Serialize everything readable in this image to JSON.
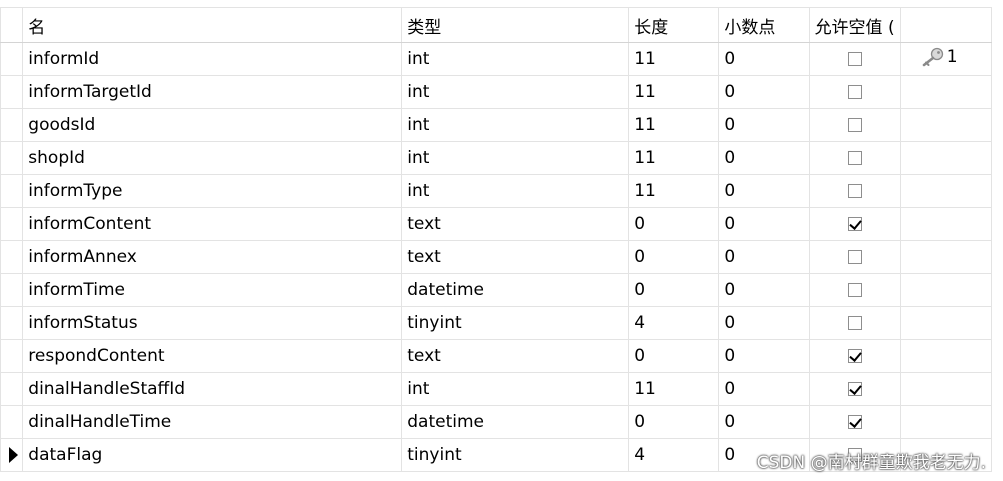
{
  "columns": {
    "name": "名",
    "type": "类型",
    "length": "长度",
    "decimals": "小数点",
    "allow_null": "允许空值 ("
  },
  "rows": [
    {
      "name": "informId",
      "type": "int",
      "length": "11",
      "decimals": "0",
      "allow_null": false,
      "key": "1",
      "current": false
    },
    {
      "name": "informTargetId",
      "type": "int",
      "length": "11",
      "decimals": "0",
      "allow_null": false,
      "key": "",
      "current": false
    },
    {
      "name": "goodsId",
      "type": "int",
      "length": "11",
      "decimals": "0",
      "allow_null": false,
      "key": "",
      "current": false
    },
    {
      "name": "shopId",
      "type": "int",
      "length": "11",
      "decimals": "0",
      "allow_null": false,
      "key": "",
      "current": false
    },
    {
      "name": "informType",
      "type": "int",
      "length": "11",
      "decimals": "0",
      "allow_null": false,
      "key": "",
      "current": false
    },
    {
      "name": "informContent",
      "type": "text",
      "length": "0",
      "decimals": "0",
      "allow_null": true,
      "key": "",
      "current": false
    },
    {
      "name": "informAnnex",
      "type": "text",
      "length": "0",
      "decimals": "0",
      "allow_null": false,
      "key": "",
      "current": false
    },
    {
      "name": "informTime",
      "type": "datetime",
      "length": "0",
      "decimals": "0",
      "allow_null": false,
      "key": "",
      "current": false
    },
    {
      "name": "informStatus",
      "type": "tinyint",
      "length": "4",
      "decimals": "0",
      "allow_null": false,
      "key": "",
      "current": false
    },
    {
      "name": "respondContent",
      "type": "text",
      "length": "0",
      "decimals": "0",
      "allow_null": true,
      "key": "",
      "current": false
    },
    {
      "name": "dinalHandleStaffId",
      "type": "int",
      "length": "11",
      "decimals": "0",
      "allow_null": true,
      "key": "",
      "current": false
    },
    {
      "name": "dinalHandleTime",
      "type": "datetime",
      "length": "0",
      "decimals": "0",
      "allow_null": true,
      "key": "",
      "current": false
    },
    {
      "name": "dataFlag",
      "type": "tinyint",
      "length": "4",
      "decimals": "0",
      "allow_null": false,
      "key": "",
      "current": true
    }
  ],
  "icons": {
    "key": "key-icon",
    "current_row": "row-pointer-icon",
    "checkbox": "checkbox"
  },
  "watermark": "CSDN @南村群童欺我老无力."
}
